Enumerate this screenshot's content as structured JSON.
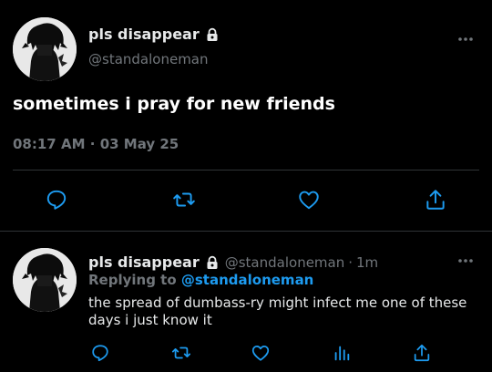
{
  "main_tweet": {
    "display_name": "pls disappear",
    "handle": "@standaloneman",
    "text": "sometimes i pray for new friends",
    "time": "08:17 AM",
    "separator": "·",
    "date": "03 May 25",
    "actions": [
      "reply-icon",
      "retweet-icon",
      "like-icon",
      "share-icon"
    ]
  },
  "reply_tweet": {
    "display_name": "pls disappear",
    "handle": "@standaloneman",
    "separator": "·",
    "time": "1m",
    "replying_label": "Replying to",
    "replying_handle": "@standaloneman",
    "text": "the spread of dumbass-ry might infect me one of these days i just know it",
    "actions": [
      "reply-icon",
      "retweet-icon",
      "like-icon",
      "views-icon",
      "share-icon"
    ]
  },
  "colors": {
    "background": "#000000",
    "primary_text": "#e7e9ea",
    "secondary_text": "#71767b",
    "accent": "#1d9bf0",
    "divider": "#2f3336"
  }
}
